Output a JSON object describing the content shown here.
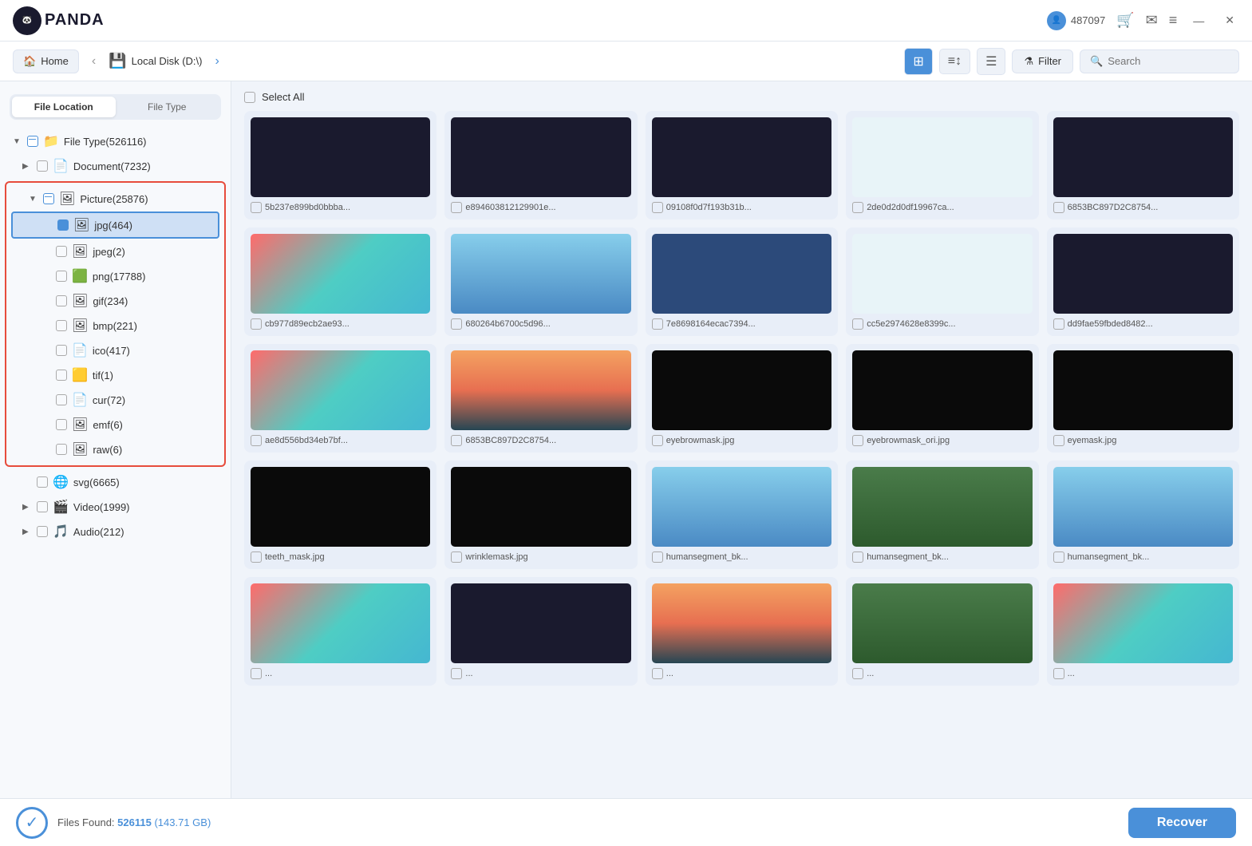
{
  "titlebar": {
    "logo_text": "PANDA",
    "user_id": "487097",
    "cart_icon": "🛒",
    "message_icon": "✉",
    "menu_icon": "≡",
    "minimize_icon": "—",
    "close_icon": "✕"
  },
  "breadcrumb": {
    "home_label": "Home",
    "nav_back": "‹",
    "nav_forward": "›",
    "disk_label": "Local Disk (D:\\)",
    "filter_label": "Filter",
    "search_placeholder": "Search"
  },
  "tabs": {
    "file_location_label": "File Location",
    "file_type_label": "File Type"
  },
  "tree": {
    "root_label": "File Type(526116)",
    "document_label": "Document(7232)",
    "picture_label": "Picture(25876)",
    "jpg_label": "jpg(464)",
    "jpeg_label": "jpeg(2)",
    "png_label": "png(17788)",
    "gif_label": "gif(234)",
    "bmp_label": "bmp(221)",
    "ico_label": "ico(417)",
    "tif_label": "tif(1)",
    "cur_label": "cur(72)",
    "emf_label": "emf(6)",
    "raw_label": "raw(6)",
    "svg_label": "svg(6665)",
    "video_label": "Video(1999)",
    "audio_label": "Audio(212)"
  },
  "content": {
    "select_all_label": "Select All",
    "items": [
      {
        "label": "5b237e899bd0bbba...",
        "thumb": "dark"
      },
      {
        "label": "e894603812129901e...",
        "thumb": "dark"
      },
      {
        "label": "09108f0d7f193b31b...",
        "thumb": "dark"
      },
      {
        "label": "2de0d2d0df19967ca...",
        "thumb": "light"
      },
      {
        "label": "6853BC897D2C8754...",
        "thumb": "dark"
      },
      {
        "label": "cb977d89ecb2ae93...",
        "thumb": "colorful"
      },
      {
        "label": "680264b6700c5d96...",
        "thumb": "sky"
      },
      {
        "label": "7e8698164ecac7394...",
        "thumb": "blue"
      },
      {
        "label": "cc5e2974628e8399c...",
        "thumb": "light"
      },
      {
        "label": "dd9fae59fbded8482...",
        "thumb": "dark"
      },
      {
        "label": "ae8d556bd34eb7bf...",
        "thumb": "colorful"
      },
      {
        "label": "6853BC897D2C8754...",
        "thumb": "sunset"
      },
      {
        "label": "eyebrowmask.jpg",
        "thumb": "black"
      },
      {
        "label": "eyebrowmask_ori.jpg",
        "thumb": "black"
      },
      {
        "label": "eyemask.jpg",
        "thumb": "black"
      },
      {
        "label": "teeth_mask.jpg",
        "thumb": "black"
      },
      {
        "label": "wrinklemask.jpg",
        "thumb": "black"
      },
      {
        "label": "humansegment_bk...",
        "thumb": "sky"
      },
      {
        "label": "humansegment_bk...",
        "thumb": "green"
      },
      {
        "label": "humansegment_bk...",
        "thumb": "sky"
      },
      {
        "label": "...",
        "thumb": "colorful"
      },
      {
        "label": "...",
        "thumb": "dark"
      },
      {
        "label": "...",
        "thumb": "sunset"
      },
      {
        "label": "...",
        "thumb": "green"
      },
      {
        "label": "...",
        "thumb": "colorful"
      }
    ]
  },
  "footer": {
    "files_found_label": "Files Found:",
    "count": "526115",
    "size": "(143.71 GB)",
    "recover_label": "Recover"
  }
}
